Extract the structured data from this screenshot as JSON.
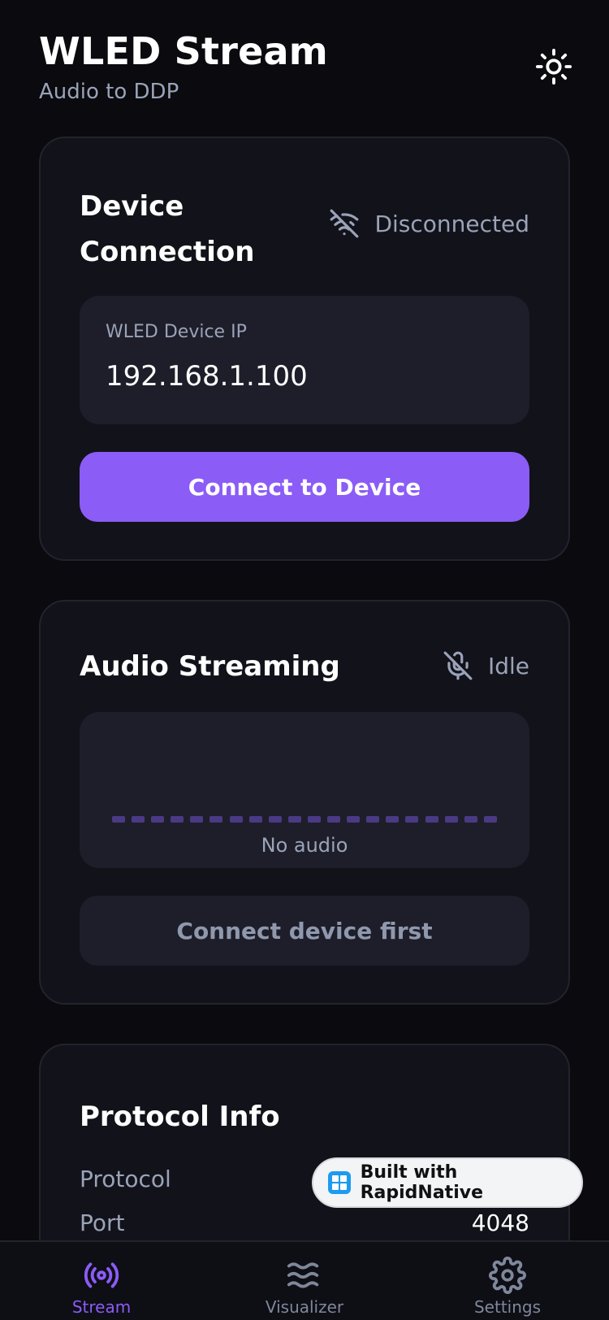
{
  "header": {
    "title": "WLED Stream",
    "subtitle": "Audio to DDP",
    "theme_icon": "sun-icon"
  },
  "device_card": {
    "title": "Device Connection",
    "status": "Disconnected",
    "status_icon": "wifi-off-icon",
    "ip_label": "WLED Device IP",
    "ip_value": "192.168.1.100",
    "connect_label": "Connect to Device"
  },
  "audio_card": {
    "title": "Audio Streaming",
    "status": "Idle",
    "status_icon": "mic-off-icon",
    "viz_empty_text": "No audio",
    "button_label": "Connect device first"
  },
  "protocol_card": {
    "title": "Protocol Info",
    "rows": [
      {
        "label": "Protocol",
        "value": ""
      },
      {
        "label": "Port",
        "value": "4048"
      }
    ]
  },
  "badge": {
    "label": "Built with RapidNative"
  },
  "nav": {
    "items": [
      {
        "label": "Stream",
        "icon": "broadcast-icon",
        "active": true
      },
      {
        "label": "Visualizer",
        "icon": "waves-icon",
        "active": false
      },
      {
        "label": "Settings",
        "icon": "gear-icon",
        "active": false
      }
    ]
  },
  "colors": {
    "background": "#0a0a0f",
    "card": "#12121a",
    "accent": "#8b5cf6",
    "muted_text": "#9aa3b8"
  }
}
